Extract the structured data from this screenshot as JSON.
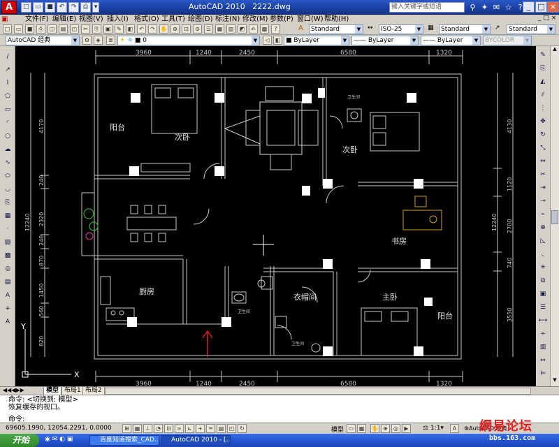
{
  "titlebar": {
    "app": "AutoCAD 2010",
    "file": "2222.dwg",
    "search_placeholder": "键入关键字或短语"
  },
  "menu": [
    "文件(F)",
    "编辑(E)",
    "视图(V)",
    "插入(I)",
    "格式(O)",
    "工具(T)",
    "绘图(D)",
    "标注(N)",
    "修改(M)",
    "参数(P)",
    "窗口(W)",
    "帮助(H)"
  ],
  "styles": {
    "text_style": "Standard",
    "dim_style": "ISO-25",
    "table_style": "Standard",
    "multileader_style": "Standard"
  },
  "workspace": "AutoCAD 经典",
  "layer": {
    "current": "0",
    "color": "ByLayer",
    "linetype": "ByLayer",
    "lineweight": "ByLayer",
    "plotstyle": "BYCOLOR"
  },
  "drawing": {
    "dims_top": [
      "3960",
      "1240",
      "2450",
      "6580",
      "1320"
    ],
    "dims_bottom": [
      "3960",
      "1240",
      "2450",
      "6580",
      "1320"
    ],
    "dims_left": [
      "4170",
      "240",
      "2320",
      "240",
      "870",
      "1450",
      "560",
      "820"
    ],
    "dims_left_total": "12240",
    "dims_right": [
      "4130",
      "1120",
      "2700",
      "740",
      "3550"
    ],
    "dims_right_total": "12240",
    "rooms": [
      "阳台",
      "次卧",
      "次卧",
      "书房",
      "厨房",
      "衣帽间",
      "主卧",
      "阳台"
    ],
    "small_labels": [
      "卫生间",
      "卫生间",
      "卫生间"
    ],
    "ucs": {
      "x": "X",
      "y": "Y"
    }
  },
  "tabs": [
    "模型",
    "布局1",
    "布局2"
  ],
  "command_lines": [
    "命令:  <切换到: 模型>",
    "恢复缓存的视口。",
    "命令:"
  ],
  "status": {
    "coords": "69605.1990, 12054.2291, 0.0000",
    "model": "模型",
    "scale": "1:1",
    "workspace": "AutoCAD 经典"
  },
  "taskbar": {
    "start": "开始",
    "tasks": [
      "百度知道搜索_CAD...",
      "AutoCAD 2010 - [..."
    ]
  },
  "watermark": {
    "brand": "網易论坛",
    "url": "bbs.163.com"
  }
}
